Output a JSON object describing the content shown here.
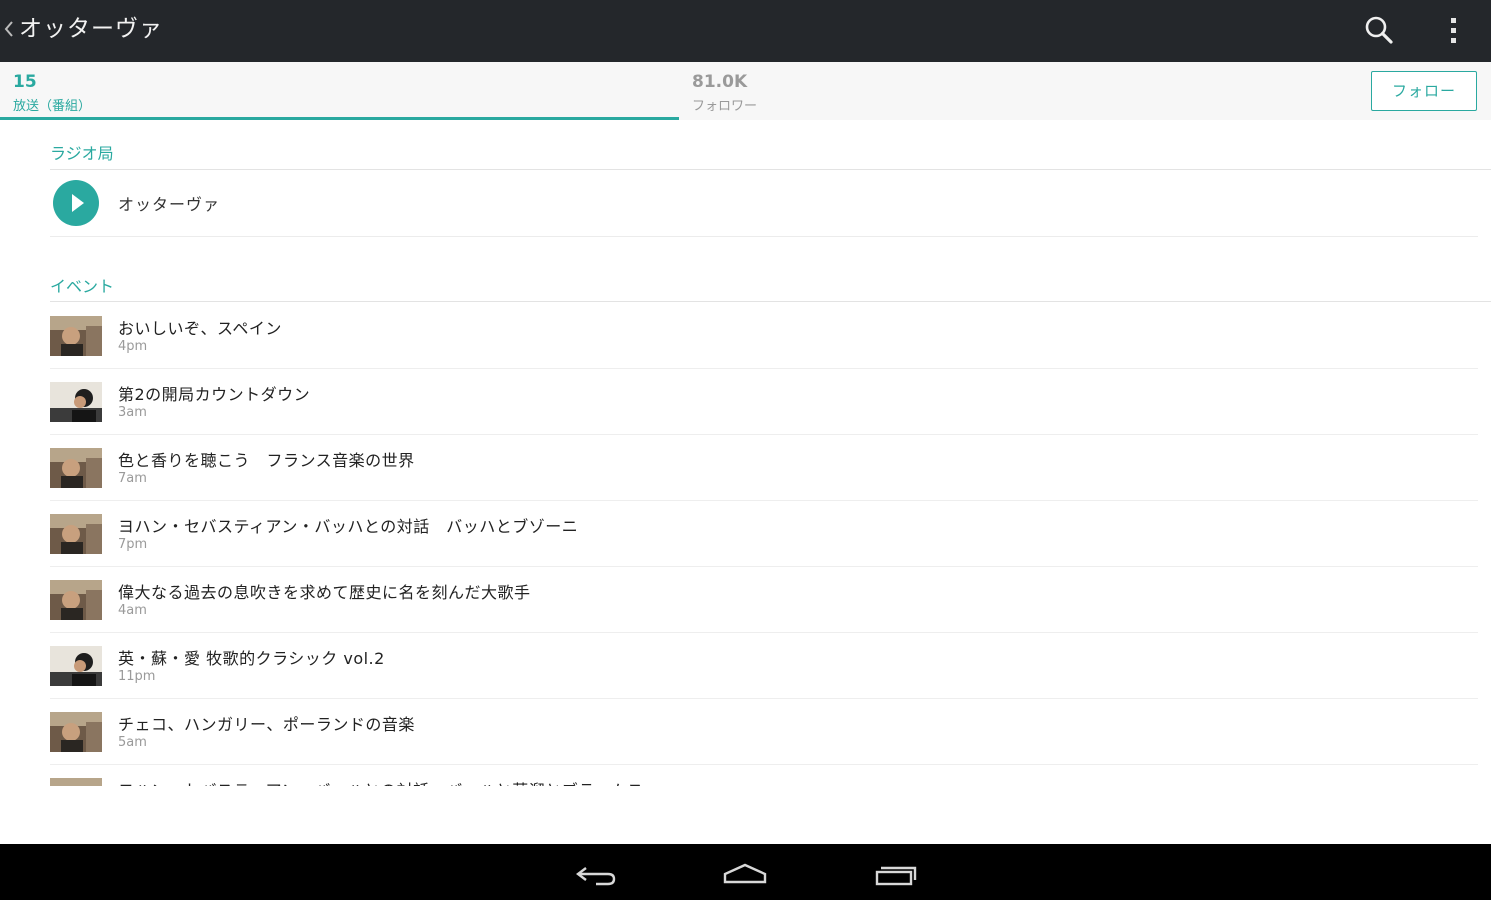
{
  "actionbar": {
    "title": "オッターヴァ",
    "search_icon": "search-icon",
    "menu_icon": "overflow-menu-icon"
  },
  "stats": {
    "broadcasts": {
      "count": "15",
      "label": "放送（番組）"
    },
    "followers": {
      "count": "81.0K",
      "label": "フォロワー"
    },
    "follow_button": "フォロー"
  },
  "stations": {
    "header": "ラジオ局",
    "items": [
      {
        "name": "オッターヴァ"
      }
    ]
  },
  "events": {
    "header": "イベント",
    "items": [
      {
        "title": "おいしいぞ、スペイン",
        "time": "4pm",
        "thumb": "a"
      },
      {
        "title": "第2の開局カウントダウン",
        "time": "3am",
        "thumb": "b"
      },
      {
        "title": "色と香りを聴こう　フランス音楽の世界",
        "time": "7am",
        "thumb": "a"
      },
      {
        "title": "ヨハン・セバスティアン・バッハとの対話　バッハとブゾーニ",
        "time": "7pm",
        "thumb": "a"
      },
      {
        "title": "偉大なる過去の息吹きを求めて歴史に名を刻んだ大歌手",
        "time": "4am",
        "thumb": "a"
      },
      {
        "title": "英・蘇・愛 牧歌的クラシック vol.2",
        "time": "11pm",
        "thumb": "b"
      },
      {
        "title": "チェコ、ハンガリー、ポーランドの音楽",
        "time": "5am",
        "thumb": "a"
      },
      {
        "title": "ヨハン・セバスティアン・バッハとの対話　バッハと蒸溜とブラームス",
        "time": "",
        "thumb": "a"
      }
    ]
  },
  "colors": {
    "accent": "#2aa9a0",
    "actionbar": "#24272b",
    "navbar": "#000000"
  },
  "navbar": {
    "back": "back-icon",
    "home": "home-icon",
    "recents": "recents-icon"
  }
}
